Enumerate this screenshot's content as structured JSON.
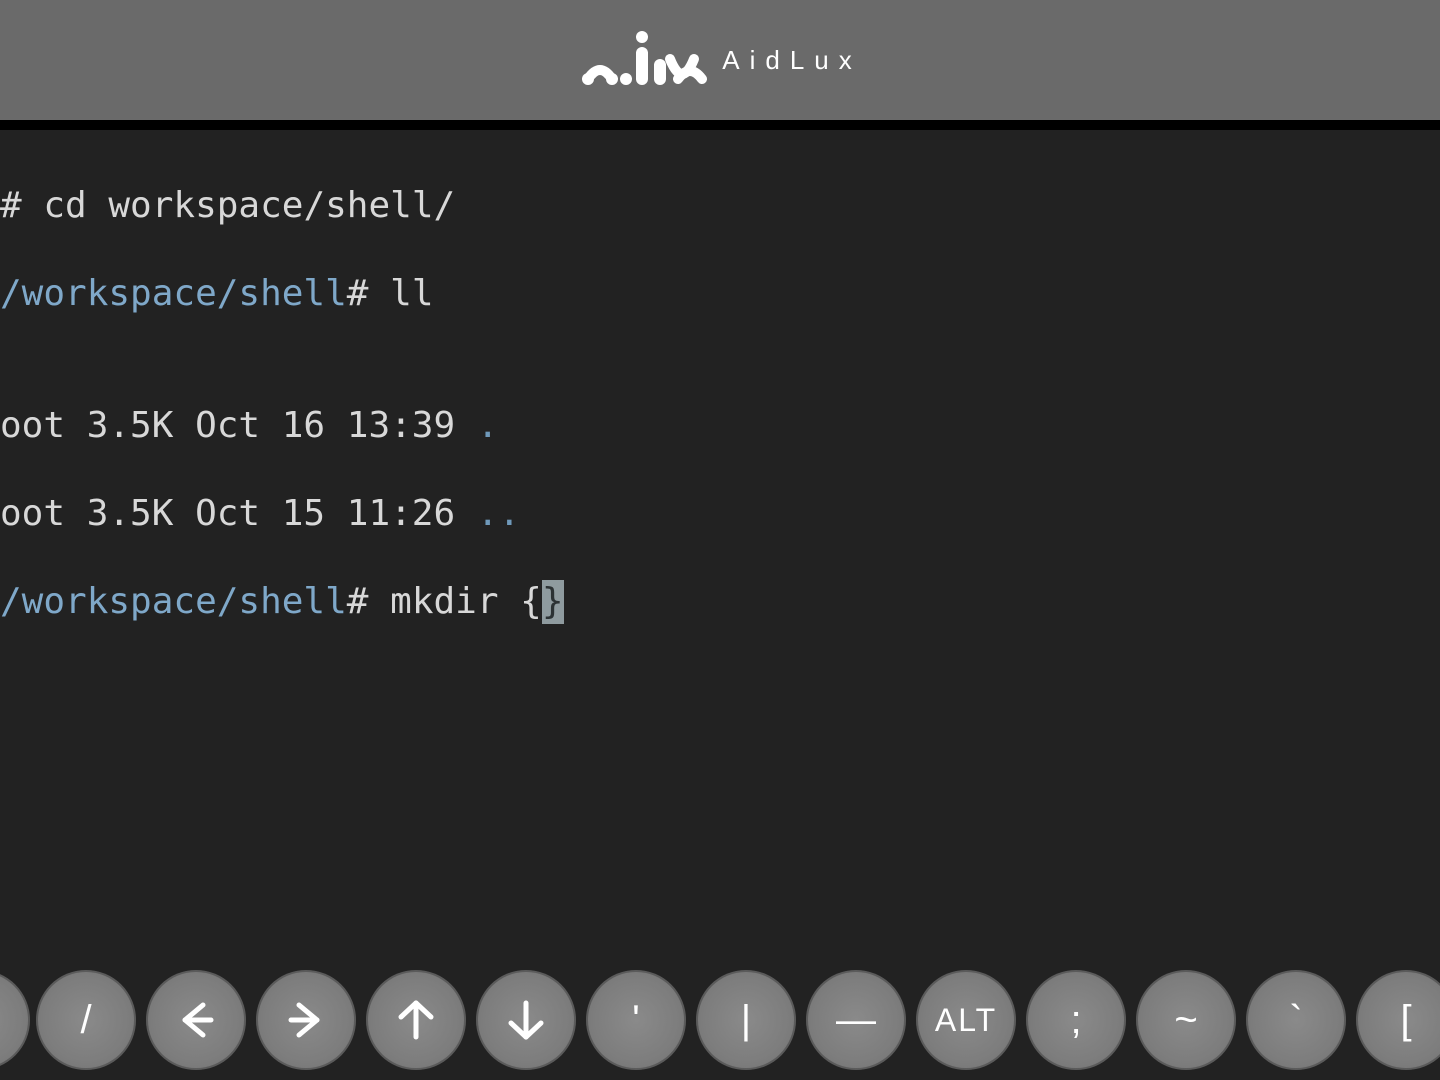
{
  "header": {
    "brand_text": "AidLux"
  },
  "terminal": {
    "lines": [
      {
        "prefix": "# ",
        "cmd": "cd workspace/shell/"
      },
      {
        "path": "/workspace/shell",
        "hash": "#",
        "cmd": " ll"
      },
      {
        "blank": ""
      },
      {
        "listing": "oot 3.5K Oct 16 13:39 ",
        "dir": "."
      },
      {
        "listing": "oot 3.5K Oct 15 11:26 ",
        "dir": ".."
      },
      {
        "path": "/workspace/shell",
        "hash": "#",
        "cmd": " mkdir {",
        "cursor": "}"
      }
    ]
  },
  "keys": [
    {
      "name": "slash-key",
      "label": "/"
    },
    {
      "name": "arrow-left-key",
      "icon": "arrow-left"
    },
    {
      "name": "arrow-right-key",
      "icon": "arrow-right"
    },
    {
      "name": "arrow-up-key",
      "icon": "arrow-up"
    },
    {
      "name": "arrow-down-key",
      "icon": "arrow-down"
    },
    {
      "name": "apostrophe-key",
      "label": "'"
    },
    {
      "name": "pipe-key",
      "label": "|"
    },
    {
      "name": "dash-key",
      "label": "—"
    },
    {
      "name": "alt-key",
      "label": "ALT",
      "cls": "alt"
    },
    {
      "name": "semicolon-key",
      "label": ";"
    },
    {
      "name": "tilde-key",
      "label": "~"
    },
    {
      "name": "backtick-key",
      "label": "`"
    },
    {
      "name": "bracket-key",
      "label": "["
    }
  ]
}
